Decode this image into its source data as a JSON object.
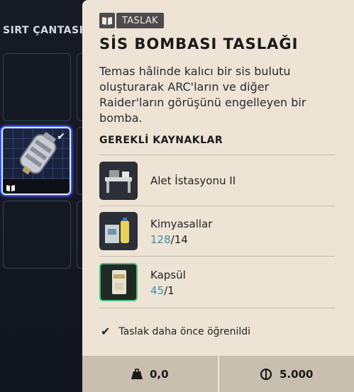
{
  "backpack": {
    "title": "SIRT ÇANTASI"
  },
  "tooltip": {
    "tag_icon": "book-icon",
    "tag_label": "TASLAK",
    "title": "SİS BOMBASI TASLAĞI",
    "description": "Temas hâlinde kalıcı bir sis bulutu oluşturarak ARC'ların ve diğer Raider'ların görüşünü engelleyen bir bomba.",
    "requirements_title": "GEREKLİ KAYNAKLAR",
    "resources": [
      {
        "name": "Alet İstasyonu II",
        "icon": "workbench-icon"
      },
      {
        "name": "Kimyasallar",
        "have": "128",
        "sep": "/",
        "need": "14",
        "icon": "chemicals-icon"
      },
      {
        "name": "Kapsül",
        "have": "45",
        "sep": "/",
        "need": "1",
        "icon": "canister-icon"
      }
    ],
    "learned_text": "Taslak daha önce öğrenildi",
    "footer": {
      "weight": "0,0",
      "weight_icon": "weight-icon",
      "value": "5.000",
      "value_icon": "coin-icon"
    }
  },
  "colors": {
    "panel_bg": "#ede4d6",
    "footer_bg": "#c9bfae",
    "qty_accent": "#3f8fa0",
    "selected_glow": "#2a5cff"
  }
}
